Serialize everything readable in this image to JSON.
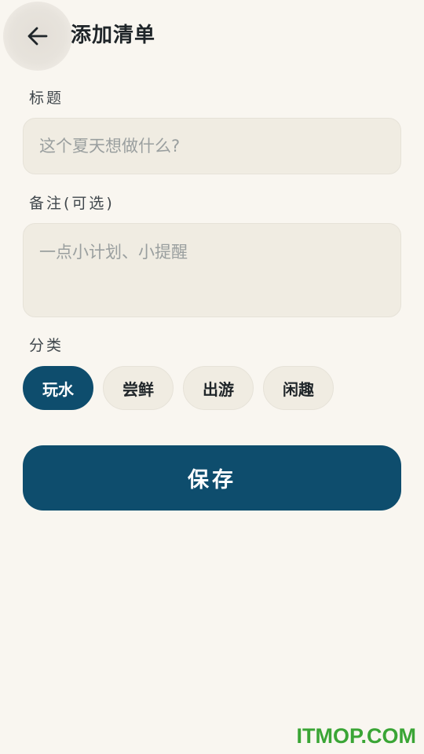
{
  "header": {
    "back_icon": "arrow-left-icon",
    "title": "添加清单"
  },
  "form": {
    "title_label": "标题",
    "title_placeholder": "这个夏天想做什么?",
    "title_value": "",
    "note_label": "备注(可选)",
    "note_placeholder": "一点小计划、小提醒",
    "note_value": "",
    "category_label": "分类",
    "categories": [
      {
        "label": "玩水",
        "selected": true
      },
      {
        "label": "尝鲜",
        "selected": false
      },
      {
        "label": "出游",
        "selected": false
      },
      {
        "label": "闲趣",
        "selected": false
      }
    ],
    "save_label": "保存"
  },
  "watermark": "ITMOP.COM",
  "colors": {
    "background": "#f9f6f0",
    "primary": "#0e4d6d",
    "field_bg": "#f0ece2",
    "watermark": "#3aa535"
  }
}
